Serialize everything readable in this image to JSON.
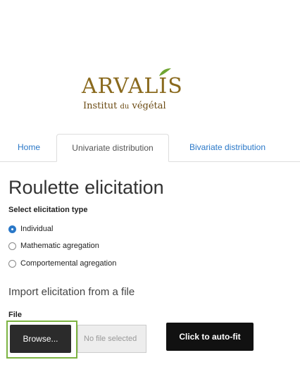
{
  "logo": {
    "main": "ARVALIS",
    "sub_prefix": "Institut ",
    "sub_small": "du",
    "sub_suffix": " végétal",
    "leaf_color": "#6fa532",
    "text_color": "#8a6a1e"
  },
  "tabs": [
    {
      "label": "Home",
      "active": false
    },
    {
      "label": "Univariate distribution",
      "active": true
    },
    {
      "label": "Bivariate distribution",
      "active": false
    }
  ],
  "main": {
    "title": "Roulette elicitation",
    "select_label": "Select elicitation type",
    "options": [
      {
        "label": "Individual",
        "checked": true
      },
      {
        "label": "Mathematic agregation",
        "checked": false
      },
      {
        "label": "Comportemental agregation",
        "checked": false
      }
    ],
    "import_title": "Import elicitation from a file",
    "file_label": "File",
    "browse_label": "Browse...",
    "file_placeholder": "No file selected",
    "autofit_label": "Click to auto-fit"
  },
  "colors": {
    "link": "#2a78c8",
    "highlight": "#7cb342",
    "button_dark": "#2b2b2b"
  }
}
